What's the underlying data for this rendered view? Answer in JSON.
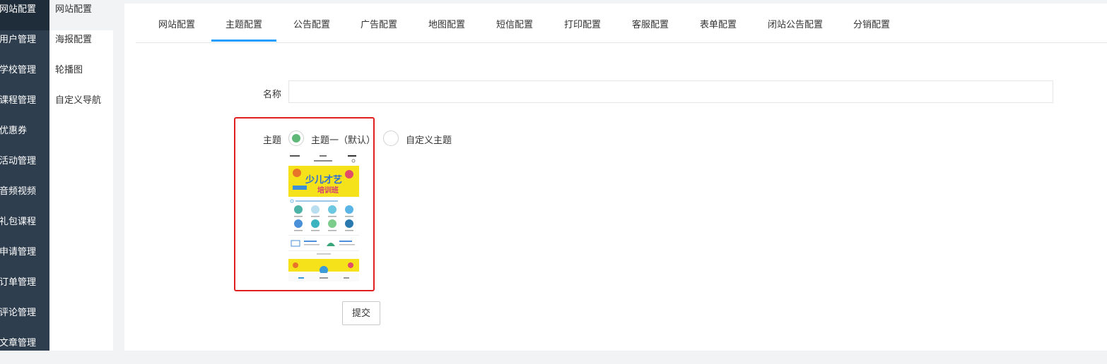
{
  "sidebar": {
    "items": [
      {
        "label": "网站配置"
      },
      {
        "label": "用户管理"
      },
      {
        "label": "学校管理"
      },
      {
        "label": "课程管理"
      },
      {
        "label": "优惠券"
      },
      {
        "label": "活动管理"
      },
      {
        "label": "音频视频"
      },
      {
        "label": "礼包课程"
      },
      {
        "label": "申请管理"
      },
      {
        "label": "订单管理"
      },
      {
        "label": "评论管理"
      },
      {
        "label": "文章管理"
      }
    ]
  },
  "subnav": {
    "items": [
      {
        "label": "网站配置"
      },
      {
        "label": "海报配置"
      },
      {
        "label": "轮播图"
      },
      {
        "label": "自定义导航"
      }
    ]
  },
  "tabs": [
    {
      "label": "网站配置"
    },
    {
      "label": "主题配置"
    },
    {
      "label": "公告配置"
    },
    {
      "label": "广告配置"
    },
    {
      "label": "地图配置"
    },
    {
      "label": "短信配置"
    },
    {
      "label": "打印配置"
    },
    {
      "label": "客服配置"
    },
    {
      "label": "表单配置"
    },
    {
      "label": "闭站公告配置"
    },
    {
      "label": "分销配置"
    }
  ],
  "form": {
    "name_label": "名称",
    "name_value": "",
    "theme_label": "主题",
    "option1_label": "主题一（默认）",
    "option2_label": "自定义主题",
    "selected_option": "主题一（默认）",
    "submit_label": "提交"
  },
  "preview": {
    "banner_text": "少儿才艺",
    "banner_text2": "培训班"
  },
  "colors": {
    "sidebar_bg": "#2f3e4e",
    "tab_active": "#1e9fff",
    "radio_checked": "#5fb878",
    "highlight_border": "#e02020",
    "banner_yellow": "#f5e21a"
  }
}
